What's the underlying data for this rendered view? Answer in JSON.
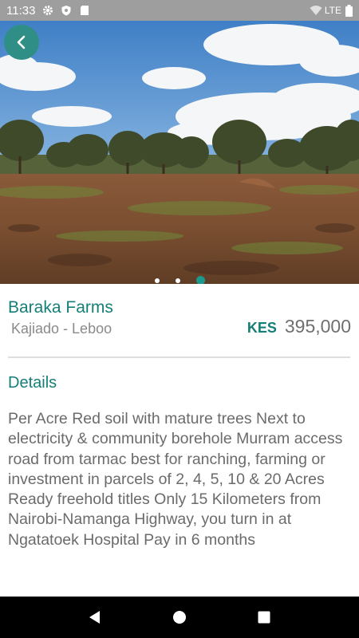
{
  "status_bar": {
    "time": "11:33",
    "network": "LTE",
    "icons": [
      "gear-icon",
      "shield-icon",
      "sd-card-icon",
      "wifi-icon",
      "battery-icon"
    ]
  },
  "gallery": {
    "image": "farmland-photo",
    "slides": 3,
    "active_slide": 3,
    "back_icon": "chevron-left-icon"
  },
  "listing": {
    "title": "Baraka Farms",
    "location": "Kajiado - Leboo",
    "currency": "KES",
    "price": "395,000"
  },
  "details": {
    "heading": "Details",
    "description": "Per Acre Red soil with mature trees Next to electricity & community borehole Murram access road from tarmac best for ranching, farming or investment in parcels of 2, 4, 5, 10 & 20 Acres Ready freehold titles Only 15 Kilometers from Nairobi-Namanga Highway, you turn in at Ngatatoek Hospital Pay in 6 months"
  },
  "colors": {
    "accent": "#157f77",
    "back_button": "#2f8f86",
    "status_bar": "#9e9e9e",
    "nav_bar": "#000000"
  },
  "nav_bar": {
    "icons": [
      "back-triangle-icon",
      "home-circle-icon",
      "recents-square-icon"
    ]
  }
}
